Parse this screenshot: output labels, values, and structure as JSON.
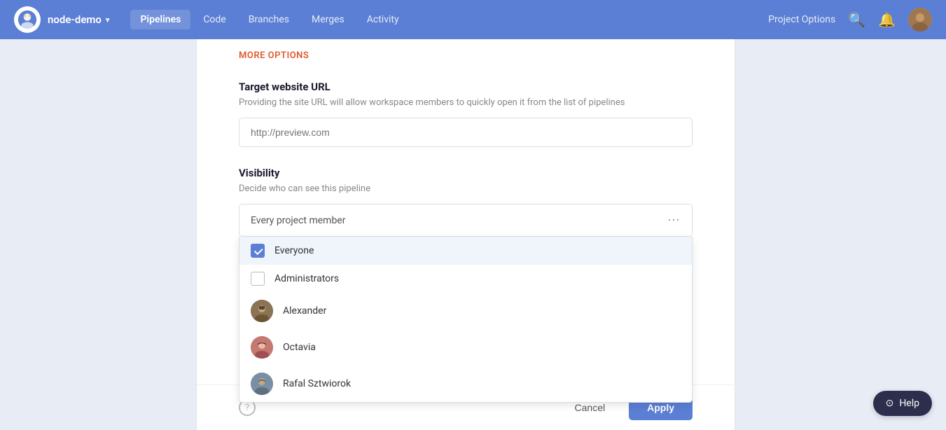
{
  "navbar": {
    "project_name": "node-demo",
    "nav_items": [
      {
        "label": "Pipelines",
        "active": true
      },
      {
        "label": "Code",
        "active": false
      },
      {
        "label": "Branches",
        "active": false
      },
      {
        "label": "Merges",
        "active": false
      },
      {
        "label": "Activity",
        "active": false
      }
    ],
    "project_options_label": "Project Options",
    "search_icon": "🔍",
    "bell_icon": "🔔"
  },
  "panel": {
    "more_options_label": "MORE OPTIONS",
    "target_url_section": {
      "title": "Target website URL",
      "description": "Providing the site URL will allow workspace members to quickly open it from the list of pipelines",
      "input_placeholder": "http://preview.com",
      "input_value": ""
    },
    "visibility_section": {
      "title": "Visibility",
      "description": "Decide who can see this pipeline",
      "dropdown_placeholder": "Every project member",
      "options": [
        {
          "id": "everyone",
          "label": "Everyone",
          "type": "checkbox",
          "checked": true
        },
        {
          "id": "administrators",
          "label": "Administrators",
          "type": "checkbox",
          "checked": false
        },
        {
          "id": "alexander",
          "label": "Alexander",
          "type": "avatar"
        },
        {
          "id": "octavia",
          "label": "Octavia",
          "type": "avatar"
        },
        {
          "id": "rafal",
          "label": "Rafal Sztwiorok",
          "type": "avatar"
        }
      ]
    },
    "footer": {
      "cancel_label": "Cancel",
      "apply_label": "Apply"
    }
  },
  "help_fab": {
    "label": "Help"
  }
}
